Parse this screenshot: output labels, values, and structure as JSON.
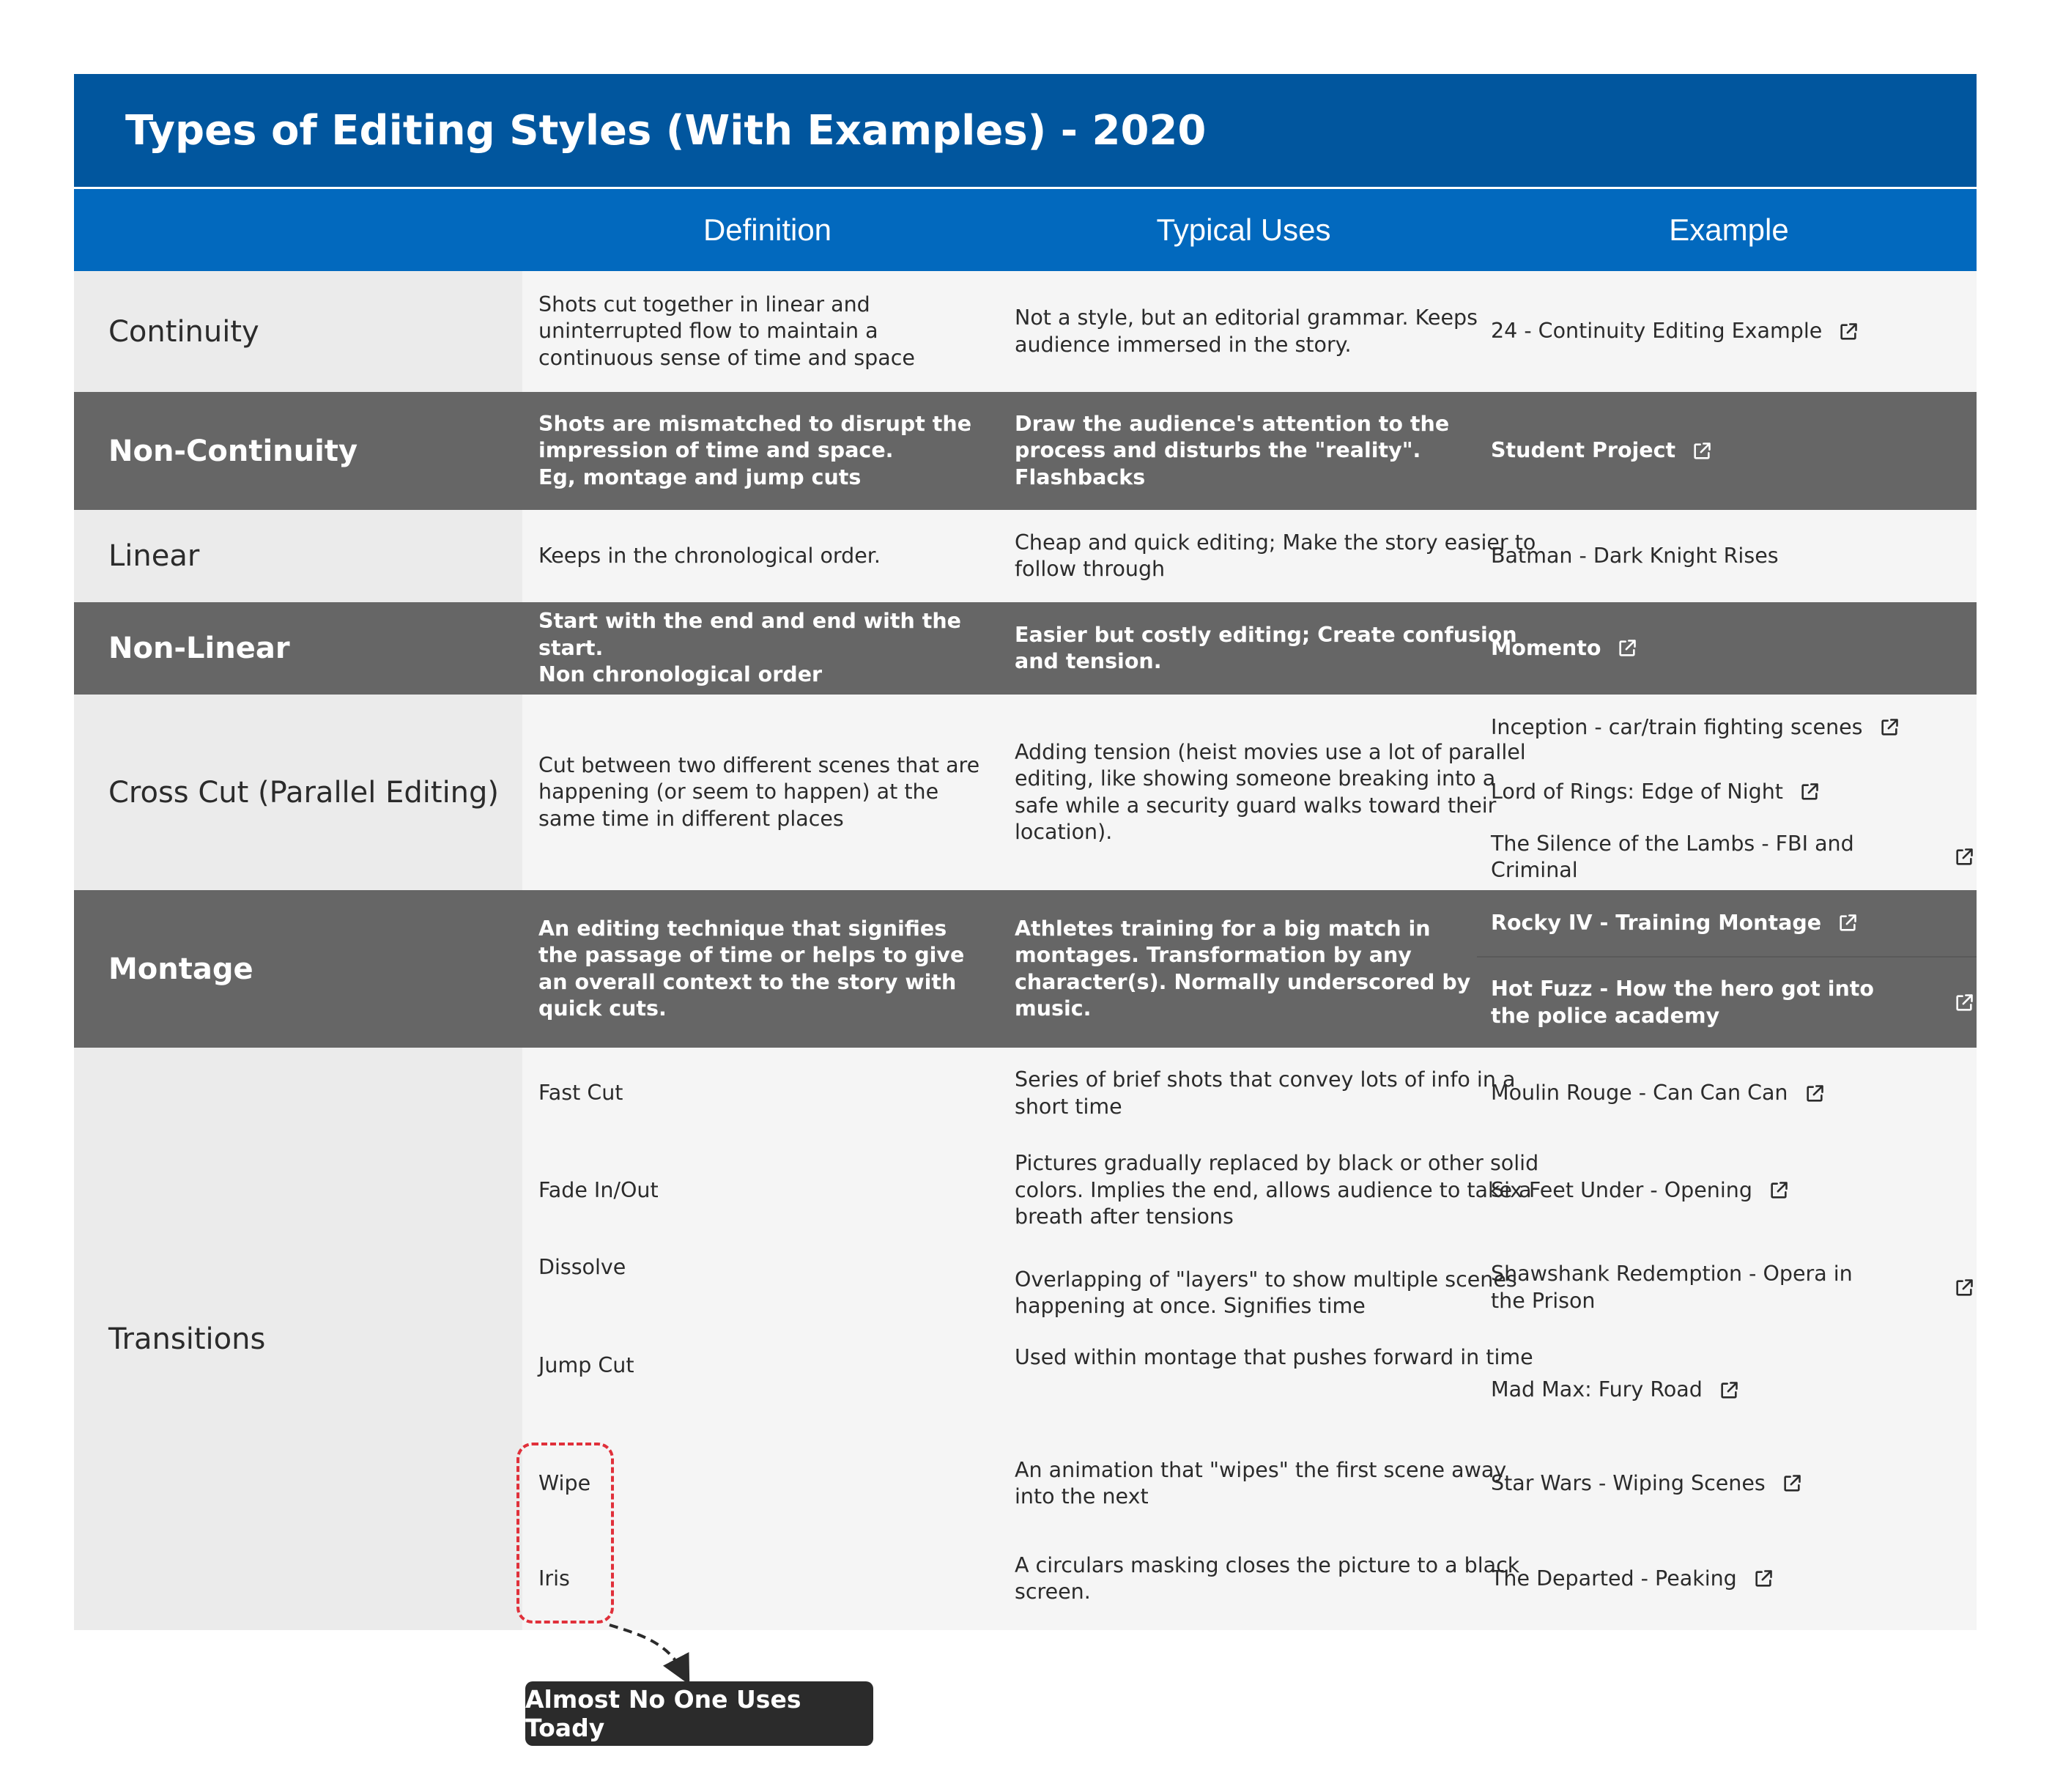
{
  "title": "Types of Editing Styles (With Examples) - 2020",
  "headers": {
    "definition": "Definition",
    "uses": "Typical Uses",
    "example": "Example"
  },
  "rows": [
    {
      "label": "Continuity",
      "definition": "Shots cut together in linear and uninterrupted flow to maintain a continuous sense of time and space",
      "uses": "Not a style, but an editorial grammar. Keeps audience immersed in the story.",
      "examples": [
        {
          "text": "24 - Continuity Editing Example",
          "icon": "external-link-icon"
        }
      ]
    },
    {
      "label": "Non-Continuity",
      "definition_lines": [
        "Shots are mismatched to disrupt the impression of time and space.",
        "Eg, montage and jump cuts"
      ],
      "uses": "Draw the audience's attention to the process and disturbs the \"reality\". Flashbacks",
      "examples": [
        {
          "text": "Student Project",
          "icon": "external-link-icon"
        }
      ]
    },
    {
      "label": "Linear",
      "definition": "Keeps in the chronological order.",
      "uses": "Cheap and quick editing; Make the story easier to follow through",
      "examples": [
        {
          "text": "Batman - Dark Knight Rises"
        }
      ]
    },
    {
      "label": "Non-Linear",
      "definition_lines": [
        "Start with the end and end with the start.",
        "Non chronological order"
      ],
      "uses": "Easier but costly editing; Create confusion and tension.",
      "examples": [
        {
          "text": "Momento",
          "icon": "external-link-icon"
        }
      ]
    },
    {
      "label": "Cross Cut (Parallel Editing)",
      "definition": "Cut between two different scenes that are happening (or seem to happen) at the same time in different places",
      "uses": "Adding tension (heist movies use a lot of parallel editing, like showing someone breaking into a safe while a security guard walks toward their location).",
      "examples": [
        {
          "text": "Inception - car/train fighting scenes",
          "icon": "external-link-icon"
        },
        {
          "text": "Lord of Rings: Edge of Night",
          "icon": "external-link-icon"
        },
        {
          "text": "The Silence of the Lambs - FBI and Criminal",
          "icon": "external-link-icon"
        }
      ]
    },
    {
      "label": "Montage",
      "definition": "An editing technique that signifies the passage of time or helps to give an overall context to the story with quick cuts.",
      "uses": "Athletes training for a big match in montages. Transformation by any character(s). Normally underscored by music.",
      "examples": [
        {
          "text": "Rocky IV - Training Montage",
          "icon": "external-link-icon"
        },
        {
          "text": "Hot Fuzz - How the hero got into the police academy",
          "icon": "external-link-icon"
        }
      ]
    },
    {
      "label": "Transitions",
      "sub": [
        {
          "definition": "Fast Cut",
          "uses": "Series of brief shots that convey lots of info in a short time",
          "example": "Moulin Rouge - Can Can Can",
          "icon": "external-link-icon"
        },
        {
          "definition": "Fade In/Out",
          "uses": "Pictures gradually replaced by black or other solid colors. Implies the end, allows audience to take a breath after tensions",
          "example": "Six Feet Under - Opening",
          "icon": "external-link-icon"
        },
        {
          "definition": "Dissolve",
          "uses": "Overlapping of \"layers\" to show multiple scenes happening at once. Signifies time",
          "example": "Shawshank Redemption - Opera in the Prison",
          "icon": "external-link-icon"
        },
        {
          "definition": "Jump Cut",
          "uses": "Used within montage that pushes forward in time",
          "example": "Mad Max: Fury Road",
          "icon": "external-link-icon"
        },
        {
          "definition": "Wipe",
          "uses": "An animation that \"wipes\" the first scene away into the next",
          "example": "Star Wars - Wiping Scenes",
          "icon": "external-link-icon"
        },
        {
          "definition": "Iris",
          "uses": "A circulars masking closes the picture to a black screen.",
          "example": "The Departed - Peaking",
          "icon": "external-link-icon"
        }
      ]
    }
  ],
  "callout": {
    "label": "Almost No One Uses Toady",
    "border_color": "#e0303a"
  },
  "colors": {
    "title_bg": "#01569e",
    "header_bg": "#0269be",
    "dark_row": "#666666",
    "light_row": "#f5f5f5"
  }
}
